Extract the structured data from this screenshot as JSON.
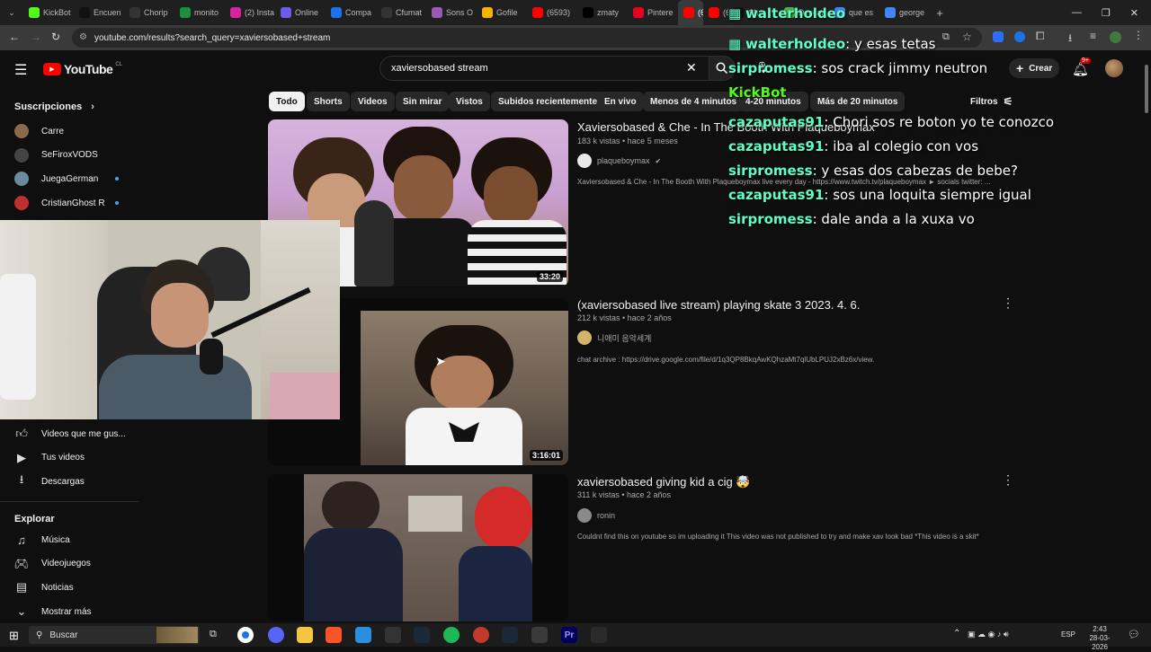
{
  "browser": {
    "tabs": [
      {
        "label": "KickBot",
        "color": "#53fc18"
      },
      {
        "label": "Encuen",
        "color": "#111111"
      },
      {
        "label": "Chorip",
        "color": "#333333"
      },
      {
        "label": "monito",
        "color": "#1e8e3e"
      },
      {
        "label": "(2) Insta",
        "color": "#d6249f"
      },
      {
        "label": "Online",
        "color": "#6c5ce7"
      },
      {
        "label": "Compa",
        "color": "#1a73e8"
      },
      {
        "label": "Cfumat",
        "color": "#333333"
      },
      {
        "label": "Sons O",
        "color": "#9b59b6"
      },
      {
        "label": "Gofile",
        "color": "#f4b400"
      },
      {
        "label": "(6593)",
        "color": "#ff0000"
      },
      {
        "label": "zmaty",
        "color": "#000000"
      },
      {
        "label": "Pintere",
        "color": "#e60023"
      },
      {
        "label": "(6",
        "color": "#ff0000"
      },
      {
        "label": "(6",
        "color": "#ff0000"
      },
      {
        "label": "Ch",
        "color": "#111111"
      },
      {
        "label": "Descar",
        "color": "#4caf50"
      },
      {
        "label": "que es",
        "color": "#4285f4"
      },
      {
        "label": "george",
        "color": "#4285f4"
      }
    ],
    "new_tab": "+",
    "url": "youtube.com/results?search_query=xaviersobased+stream",
    "window_controls": [
      "—",
      "❐",
      "✕"
    ]
  },
  "youtube": {
    "logo_text": "YouTube",
    "region": "CL",
    "search_value": "xaviersobased stream",
    "create_label": "Crear",
    "notif_badge": "9+",
    "filters_label": "Filtros",
    "chips": [
      {
        "label": "Todo",
        "selected": true
      },
      {
        "label": "Shorts"
      },
      {
        "label": "Videos"
      },
      {
        "label": "Sin mirar"
      },
      {
        "label": "Vistos"
      },
      {
        "label": "Subidos recientemente"
      },
      {
        "label": "En vivo"
      },
      {
        "label": "Menos de 4 minutos"
      },
      {
        "label": "4-20 minutos"
      },
      {
        "label": "Más de 20 minutos"
      }
    ]
  },
  "sidebar": {
    "subscriptions_heading": "Suscripciones",
    "subs": [
      {
        "label": "Carre",
        "live": false
      },
      {
        "label": "SeFiroxVODS",
        "live": false
      },
      {
        "label": "JuegaGerman",
        "live": true
      },
      {
        "label": "CristianGhost R",
        "live": true
      }
    ],
    "you_items": [
      {
        "label": "Videos que me gus...",
        "icon": "like-icon"
      },
      {
        "label": "Tus videos",
        "icon": "play-square-icon"
      },
      {
        "label": "Descargas",
        "icon": "download-icon"
      }
    ],
    "explore_heading": "Explorar",
    "explore_items": [
      {
        "label": "Música",
        "icon": "music-icon"
      },
      {
        "label": "Videojuegos",
        "icon": "gamepad-icon"
      },
      {
        "label": "Noticias",
        "icon": "news-icon"
      },
      {
        "label": "Mostrar más",
        "icon": "chevron-down-icon"
      }
    ]
  },
  "results": [
    {
      "title": "Xaviersobased & Che - In The Booth With Plaqueboymax",
      "meta": "183 k vistas • hace 5 meses",
      "channel": "plaqueboymax",
      "verified": true,
      "description": "Xaviersobased & Che - In The Booth With Plaqueboymax live every day - https://www.twitch.tv/plaqueboymax ► socials twitter: ...",
      "duration": "33:20"
    },
    {
      "title": "(xaviersobased live stream) playing skate 3 2023. 4. 6.",
      "meta": "212 k vistas • hace 2 años",
      "channel": "니애미 음악세계",
      "verified": false,
      "description": "chat archive : https://drive.google.com/file/d/1q3QP8BkqAwKQhzaMt7qlUbLPUJ2xBz6x/view.",
      "duration": "3:16:01"
    },
    {
      "title": "xaviersobased giving kid a cig 🤯",
      "meta": "311 k vistas • hace 2 años",
      "channel": "ronin",
      "verified": false,
      "description": "Couldnt find this on youtube so im uploading it This video was not published to try and make xav look bad *This video is a skit*",
      "duration": ""
    }
  ],
  "chat_overlay": [
    {
      "user": "walterholdeo",
      "message": ""
    },
    {
      "user": "walterholdeo",
      "message": "y esas tetas"
    },
    {
      "user": "sirpromess",
      "message": "sos crack jimmy neutron"
    },
    {
      "user": "KickBot",
      "message": ""
    },
    {
      "user": "cazaputas91",
      "message": "Chori sos re boton yo te conozco"
    },
    {
      "user": "cazaputas91",
      "message": "iba al colegio con vos"
    },
    {
      "user": "sirpromess",
      "message": "y esas dos cabezas de bebe?"
    },
    {
      "user": "cazaputas91",
      "message": "sos una loquita siempre igual"
    },
    {
      "user": "sirpromess",
      "message": "dale anda a la xuxa vo"
    }
  ],
  "taskbar": {
    "search_placeholder": "Buscar",
    "language": "ESP",
    "time": "2:43",
    "date": "28-03-2026"
  }
}
